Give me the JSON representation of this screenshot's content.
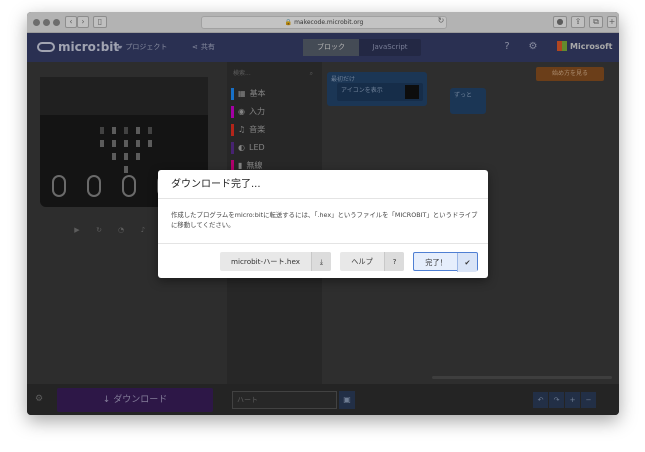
{
  "browser": {
    "url": "makecode.microbit.org"
  },
  "toolbar": {
    "logo": "micro:bit",
    "projects_label": "プロジェクト",
    "share_label": "共有",
    "blocks_label": "ブロック",
    "javascript_label": "JavaScript",
    "microsoft_label": "Microsoft"
  },
  "palette": {
    "search_placeholder": "検索...",
    "items": [
      {
        "label": "基本",
        "color": "#1e90ff"
      },
      {
        "label": "入力",
        "color": "#d400d4"
      },
      {
        "label": "音楽",
        "color": "#e63022"
      },
      {
        "label": "LED",
        "color": "#5c2d91"
      },
      {
        "label": "無線",
        "color": "#e3008c"
      }
    ]
  },
  "workspace": {
    "start_block_label": "最初だけ",
    "icon_block_label": "アイコンを表示",
    "forever_block_label": "ずっと",
    "getting_started_label": "始め方を見る"
  },
  "bottombar": {
    "download_label": "ダウンロード",
    "project_name": "ハート"
  },
  "modal": {
    "title": "ダウンロード完了...",
    "body": "作成したプログラムをmicro:bitに転送するには、「.hex」というファイルを「MICROBIT」というドライブに移動してください。",
    "file_button_label": "microbit-ハート.hex",
    "help_button_label": "ヘルプ",
    "done_button_label": "完了！"
  }
}
